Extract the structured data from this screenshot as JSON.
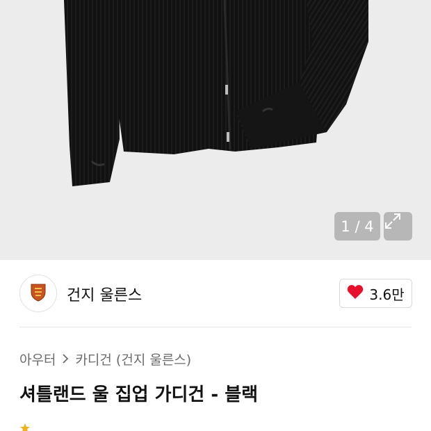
{
  "gallery": {
    "counter": "1 / 4",
    "image_alt": "black wool zip-up cardigan"
  },
  "brand": {
    "name": "건지 울른스",
    "logo_icon": "guernsey-crest-icon"
  },
  "like": {
    "icon": "heart-icon",
    "count": "3.6만",
    "color": "#e8112d"
  },
  "breadcrumb": {
    "items": [
      "아우터",
      "카디건 (건지 울른스)"
    ]
  },
  "product": {
    "title": "셔틀랜드 울 집업 가디건 - 블랙"
  }
}
